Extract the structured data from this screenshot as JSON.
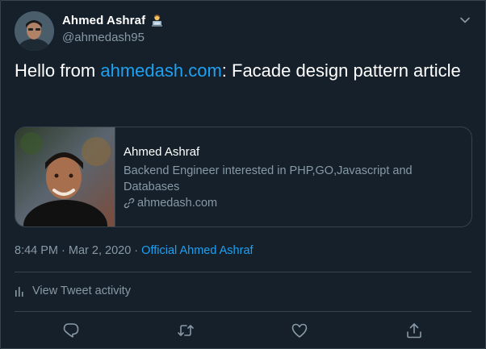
{
  "author": {
    "name": "Ahmed Ashraf",
    "handle": "@ahmedash95",
    "emoji_icon": "technologist-emoji-icon"
  },
  "tweet": {
    "text_prefix": "Hello from ",
    "link_text": "ahmedash.com",
    "text_suffix": ": Facade design pattern article"
  },
  "card": {
    "title": "Ahmed Ashraf",
    "description": "Backend Engineer interested in PHP,GO,Javascript and Databases",
    "domain": "ahmedash.com",
    "domain_icon": "link-icon"
  },
  "meta": {
    "time": "8:44 PM",
    "separator": " · ",
    "date": "Mar 2, 2020",
    "source": "Official Ahmed Ashraf"
  },
  "activity": {
    "label": "View Tweet activity",
    "icon": "bar-chart-icon"
  },
  "actions": [
    {
      "name": "reply",
      "icon": "reply-icon"
    },
    {
      "name": "retweet",
      "icon": "retweet-icon"
    },
    {
      "name": "like",
      "icon": "heart-icon"
    },
    {
      "name": "share",
      "icon": "share-icon"
    }
  ],
  "colors": {
    "background": "#15202b",
    "border": "#38444d",
    "secondary_text": "#8899a6",
    "accent": "#1da1f2"
  }
}
